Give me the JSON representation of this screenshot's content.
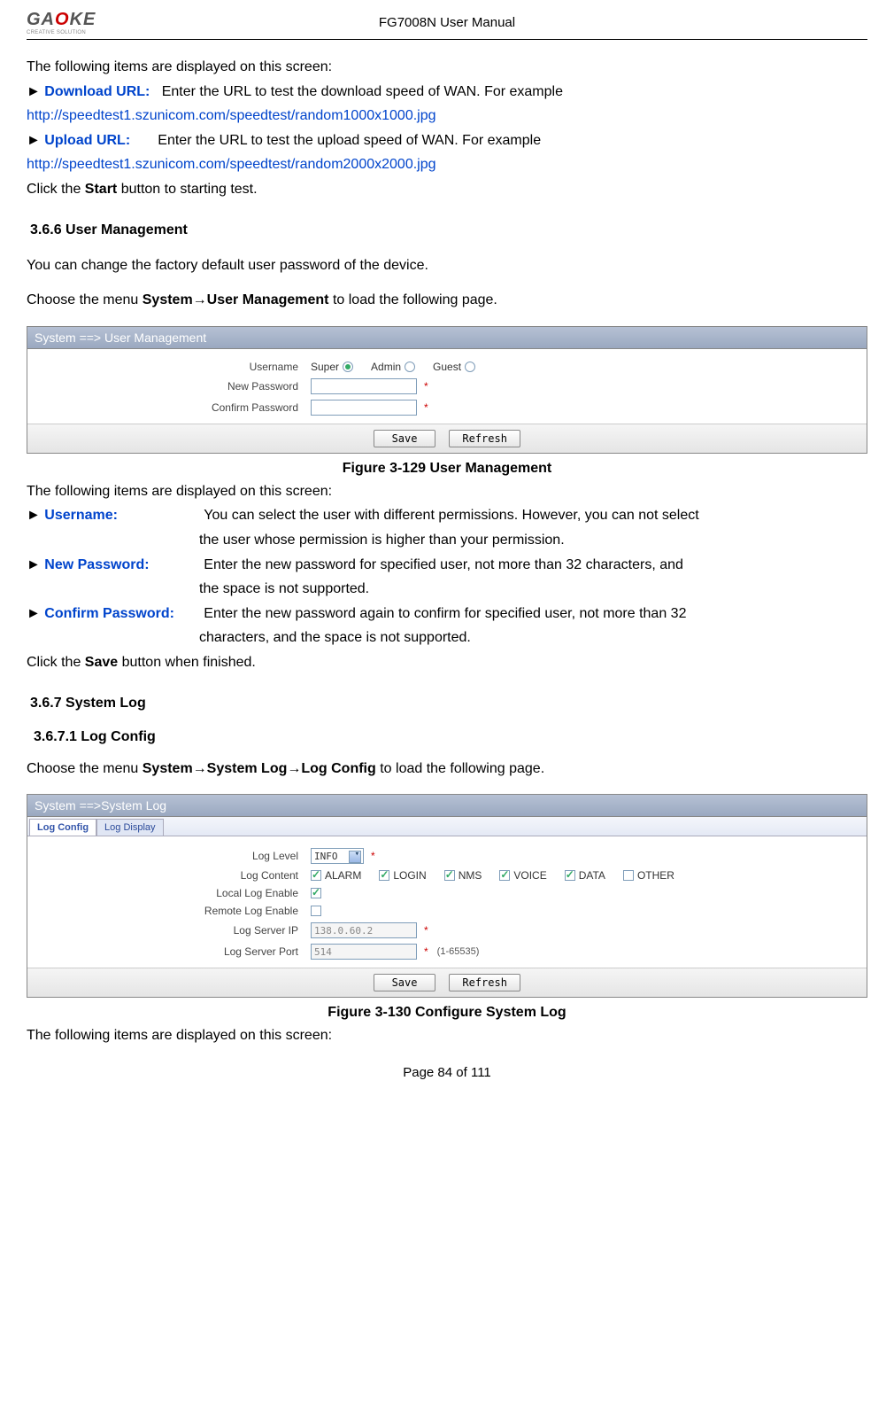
{
  "header": {
    "logo_main_left": "GA",
    "logo_main_red": "O",
    "logo_main_right": "KE",
    "logo_sub": "CREATIVE SOLUTION",
    "title": "FG7008N User Manual"
  },
  "intro": {
    "line1": "The following items are displayed on this screen:",
    "download_label": "Download URL:",
    "download_desc": "Enter the URL to test the download speed of WAN. For example",
    "download_url": "http://speedtest1.szunicom.com/speedtest/random1000x1000.jpg",
    "upload_label": "Upload URL:",
    "upload_desc": "Enter the URL to test the upload speed of WAN. For example",
    "upload_url": "http://speedtest1.szunicom.com/speedtest/random2000x2000.jpg",
    "click_start_pre": "Click the ",
    "click_start_bold": "Start",
    "click_start_post": " button to starting test."
  },
  "s366": {
    "heading": "3.6.6    User Management",
    "line1": "You can change the factory default user password of the device.",
    "nav_pre": "Choose the menu ",
    "nav_bold": "System→User Management",
    "nav_post": " to load the following page."
  },
  "fig129": {
    "breadcrumb": "System ==> User Management",
    "labels": {
      "username": "Username",
      "newpw": "New Password",
      "confpw": "Confirm Password"
    },
    "radios": {
      "super": "Super",
      "admin": "Admin",
      "guest": "Guest"
    },
    "buttons": {
      "save": "Save",
      "refresh": "Refresh"
    },
    "caption": "Figure 3-129  User Management"
  },
  "desc129": {
    "line1": "The following items are displayed on this screen:",
    "username_label": "Username:",
    "username_desc1": "You can select the user with different permissions. However, you can not select",
    "username_desc2": "the user whose permission is higher than your permission.",
    "newpw_label": "New Password:",
    "newpw_desc1": "Enter the new password for specified user, not more than 32 characters, and",
    "newpw_desc2": "the space is not supported.",
    "confpw_label": "Confirm Password:",
    "confpw_desc1": "Enter the new password again to confirm for specified user, not more than 32",
    "confpw_desc2": "characters, and the space is not supported.",
    "click_save_pre": "Click the ",
    "click_save_bold": "Save",
    "click_save_post": " button when finished."
  },
  "s367": {
    "heading": "3.6.7    System Log",
    "sub": "3.6.7.1      Log Config",
    "nav_pre": "Choose the menu ",
    "nav_bold": "System→System Log→Log Config",
    "nav_post": " to load the following page."
  },
  "fig130": {
    "breadcrumb": "System ==>System Log",
    "tabs": {
      "config": "Log Config",
      "display": "Log Display"
    },
    "labels": {
      "level": "Log Level",
      "content": "Log Content",
      "local": "Local Log Enable",
      "remote": "Remote Log Enable",
      "server_ip": "Log Server IP",
      "server_port": "Log Server Port"
    },
    "level_value": "INFO",
    "content_opts": {
      "alarm": "ALARM",
      "login": "LOGIN",
      "nms": "NMS",
      "voice": "VOICE",
      "data": "DATA",
      "other": "OTHER"
    },
    "server_ip_value": "138.0.60.2",
    "server_port_value": "514",
    "port_hint": "(1-65535)",
    "buttons": {
      "save": "Save",
      "refresh": "Refresh"
    },
    "caption": "Figure 3-130  Configure System Log"
  },
  "tail": {
    "line1": "The following items are displayed on this screen:"
  },
  "footer": {
    "text": "Page 84 of 111"
  }
}
